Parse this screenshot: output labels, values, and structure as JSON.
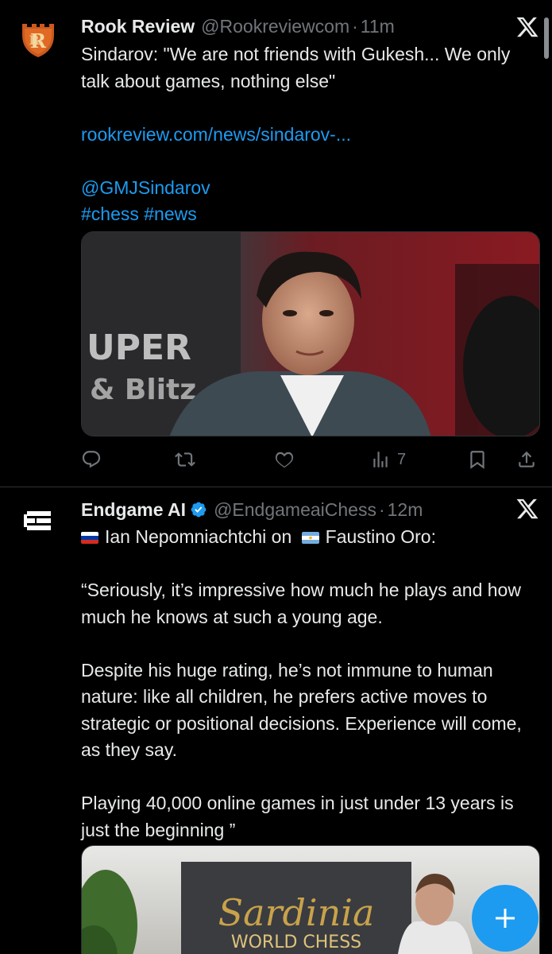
{
  "tweets": [
    {
      "author_name": "Rook Review",
      "handle": "@Rookreviewcom",
      "separator": "·",
      "time": "11m",
      "text": "Sindarov: \"We are not friends with Gukesh... We only talk about games, nothing else\"",
      "link": "rookreview.com/news/sindarov-...",
      "mention": "@GMJSindarov",
      "hashtags": "#chess #news",
      "media_desc_icon": "photo",
      "views": "7",
      "avatar_icon": "rook-review-shield-logo"
    },
    {
      "author_name": "Endgame AI",
      "handle": "@EndgameaiChess",
      "separator": "·",
      "time": "12m",
      "verified": true,
      "line1_a": "Ian Nepomniachtchi on",
      "line1_b": "Faustino Oro:",
      "para1": "“Seriously, it’s impressive how much he plays and how much he knows at such a young age.",
      "para2": "Despite his huge rating, he’s not immune to human nature: like all children, he prefers active moves to strategic or positional decisions. Experience will come, as they say.",
      "para3": "Playing 40,000 online games in just under 13 years is just the beginning ”",
      "avatar_icon": "endgame-ai-logo"
    }
  ],
  "colors": {
    "background": "#000000",
    "text": "#e7e9ea",
    "secondary": "#71767b",
    "accent": "#1d9bf0"
  },
  "fab_icon": "plus-icon"
}
